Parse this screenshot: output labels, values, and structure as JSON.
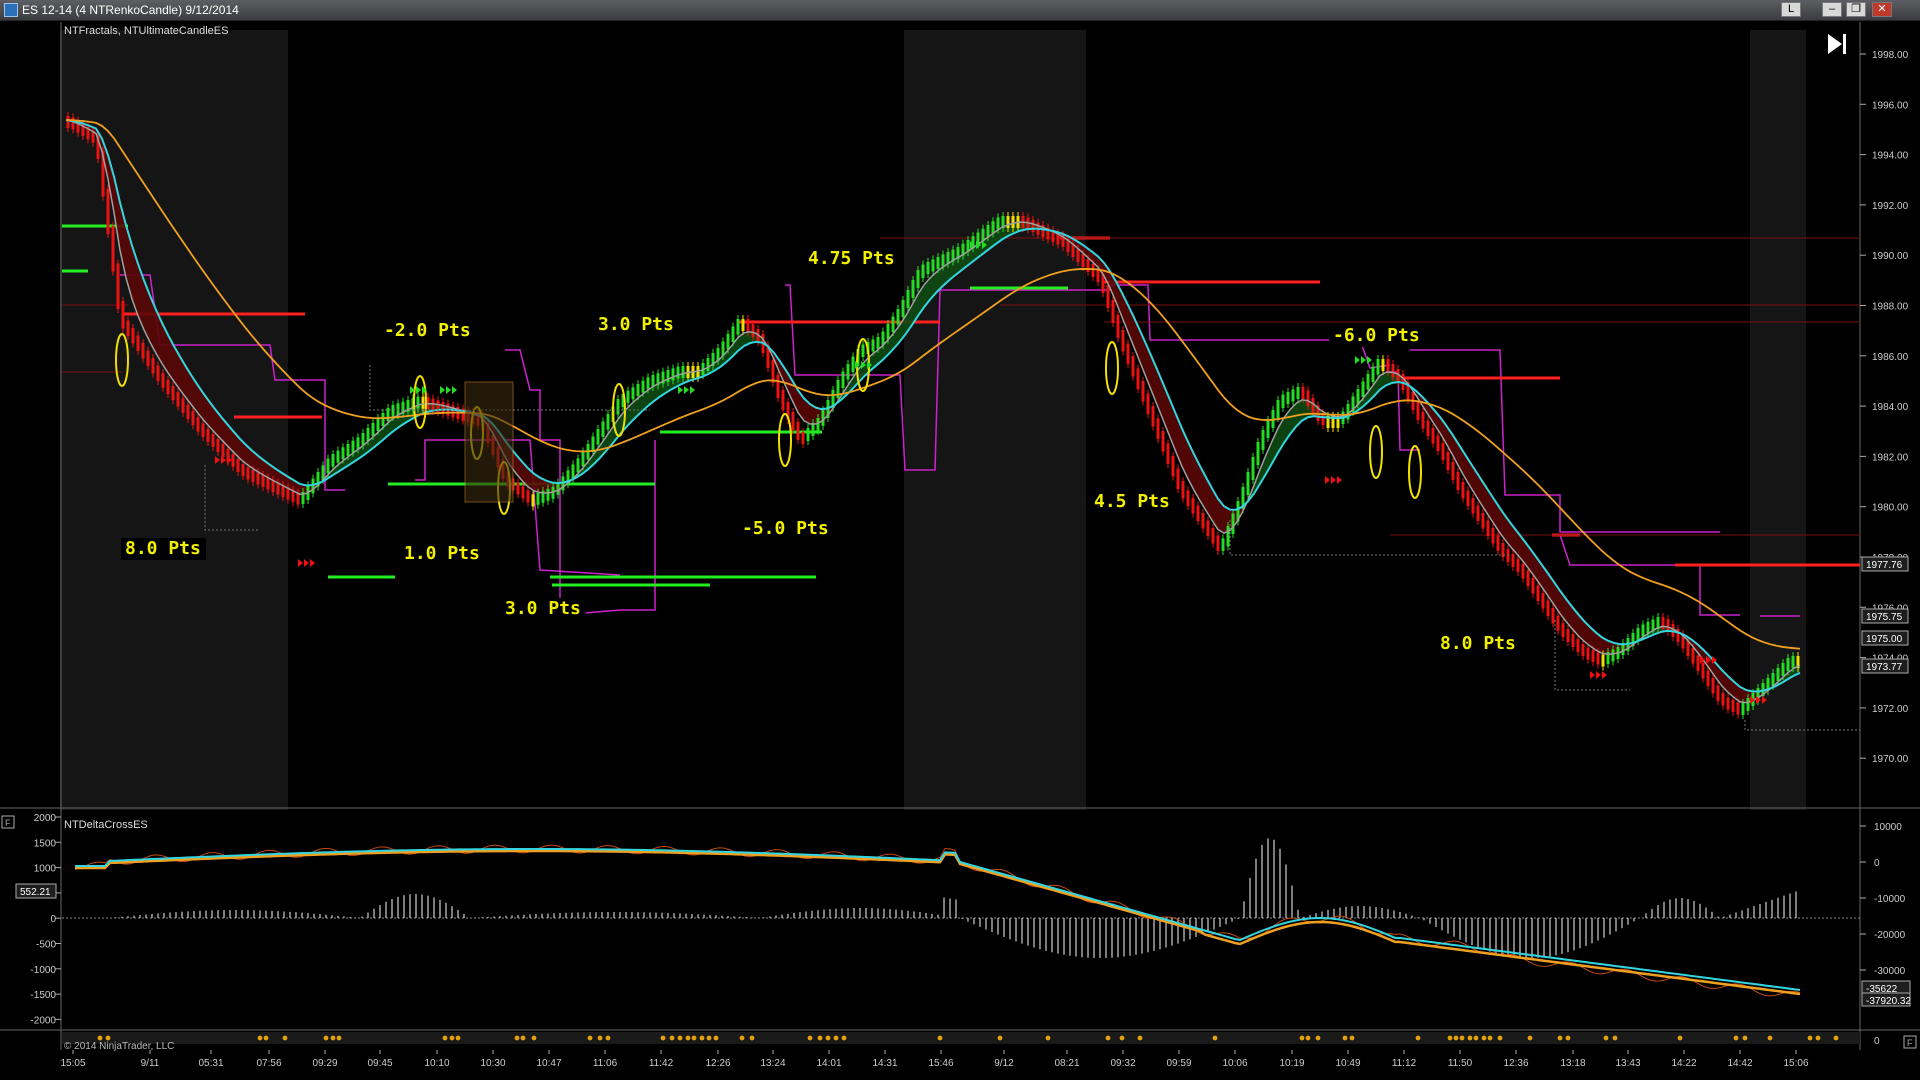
{
  "window": {
    "title": "ES 12-14 (4 NTRenkoCandle)  9/12/2014",
    "layout_label": "L"
  },
  "colors": {
    "background": "#000000",
    "bull_candle": "#22dd22",
    "bear_candle": "#ee1111",
    "neutral_candle": "#f0e000",
    "fast_ma": "#33d6e0",
    "slow_ma": "#f0a020",
    "mid_ma": "#a0a0a0",
    "stop_line": "#cc22cc",
    "trade_label": "#f0f000",
    "resistance": "#ff2020",
    "support": "#22ee22"
  },
  "main_panel": {
    "indicator_label": "NTFractals, NTUltimateCandleES",
    "trade_labels": [
      "8.0 Pts",
      "-2.0 Pts",
      "1.0 Pts",
      "3.0 Pts",
      "3.0 Pts",
      "4.75 Pts",
      "-5.0 Pts",
      "4.5 Pts",
      "-6.0 Pts",
      "8.0 Pts"
    ],
    "price_axis_ticks": [
      "1998.00",
      "1996.00",
      "1994.00",
      "1992.00",
      "1990.00",
      "1988.00",
      "1986.00",
      "1984.00",
      "1982.00",
      "1980.00",
      "1978.00",
      "1976.00",
      "1974.00",
      "1972.00",
      "1970.00"
    ],
    "price_markers": [
      "1977.76",
      "1975.75",
      "1975.00",
      "1973.77"
    ]
  },
  "lower_panel": {
    "indicator_label": "NTDeltaCrossES",
    "left_axis_ticks": [
      "2000",
      "1500",
      "1000",
      "500",
      "0",
      "-500",
      "-1000",
      "-1500",
      "-2000"
    ],
    "left_marker": "552.21",
    "right_axis_ticks": [
      "10000",
      "0",
      "-10000",
      "-20000",
      "-30000"
    ],
    "right_markers": [
      "-35622",
      "-37920.32"
    ],
    "right_zero": "0",
    "collapse_icon_label": "F"
  },
  "time_axis": {
    "labels": [
      "15:05",
      "9/11",
      "05:31",
      "07:56",
      "09:29",
      "09:45",
      "10:10",
      "10:30",
      "10:47",
      "11:06",
      "11:42",
      "12:26",
      "13:24",
      "14:01",
      "14:31",
      "15:46",
      "9/12",
      "08:21",
      "09:32",
      "09:59",
      "10:06",
      "10:19",
      "10:49",
      "11:12",
      "11:50",
      "12:36",
      "13:18",
      "13:43",
      "14:22",
      "14:42",
      "15:06"
    ]
  },
  "footer": {
    "copyright": "© 2014 NinjaTrader, LLC"
  }
}
